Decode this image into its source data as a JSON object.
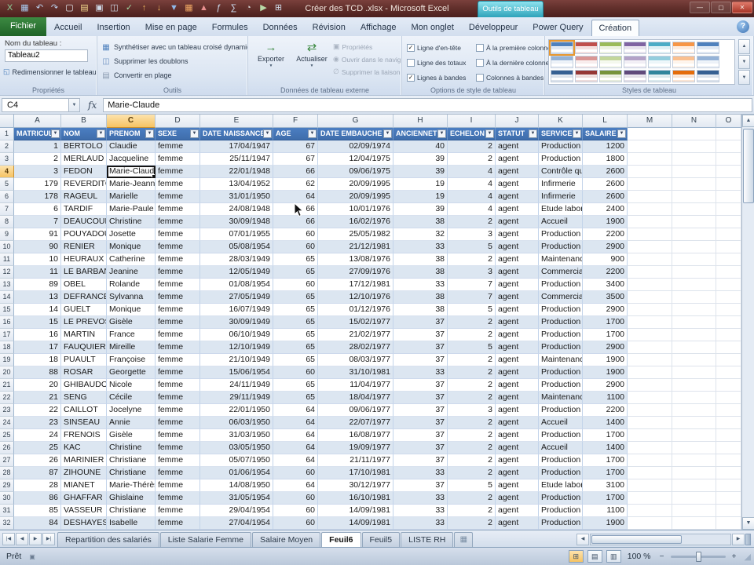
{
  "title_bar": {
    "title": "Créer des TCD .xlsx - Microsoft Excel",
    "context_label": "Outils de tableau",
    "window_controls": {
      "minimize": "—",
      "maximize": "▢",
      "close": "✕"
    },
    "qat_icons": [
      {
        "name": "excel-logo-icon",
        "glyph": "X",
        "color": "#8fd49a"
      },
      {
        "name": "save-icon",
        "glyph": "▦",
        "color": "#a9c9ee"
      },
      {
        "name": "undo-icon",
        "glyph": "↶",
        "color": "#bcd2ee"
      },
      {
        "name": "redo-icon",
        "glyph": "↷",
        "color": "#bcd2ee"
      },
      {
        "name": "new-workbook-icon",
        "glyph": "▢",
        "color": "#e8eef5"
      },
      {
        "name": "open-icon",
        "glyph": "▤",
        "color": "#f4d98e"
      },
      {
        "name": "quick-print-icon",
        "glyph": "▣",
        "color": "#cfd8e6"
      },
      {
        "name": "print-preview-icon",
        "glyph": "◫",
        "color": "#cfd8e6"
      },
      {
        "name": "spelling-icon",
        "glyph": "✓",
        "color": "#9fd49f"
      },
      {
        "name": "sort-asc-icon",
        "glyph": "↑",
        "color": "#f0b65e"
      },
      {
        "name": "sort-desc-icon",
        "glyph": "↓",
        "color": "#f0b65e"
      },
      {
        "name": "filter-icon",
        "glyph": "▼",
        "color": "#8fb7e8"
      },
      {
        "name": "pivot-table-icon",
        "glyph": "▦",
        "color": "#f0a864"
      },
      {
        "name": "chart-icon",
        "glyph": "▲",
        "color": "#e88f8f"
      },
      {
        "name": "insert-function-icon",
        "glyph": "ƒ",
        "color": "#cfe0f4"
      },
      {
        "name": "autosum-icon",
        "glyph": "∑",
        "color": "#cfe0f4"
      },
      {
        "name": "camera-icon",
        "glyph": "◔",
        "color": "#d8d8d8"
      },
      {
        "name": "macro-icon",
        "glyph": "▶",
        "color": "#b9d9a8"
      },
      {
        "name": "calculator-icon",
        "glyph": "⊞",
        "color": "#d0dcea"
      }
    ]
  },
  "ribbon": {
    "help_label": "?",
    "tabs": [
      {
        "label": "Fichier",
        "file": true
      },
      {
        "label": "Accueil"
      },
      {
        "label": "Insertion"
      },
      {
        "label": "Mise en page"
      },
      {
        "label": "Formules"
      },
      {
        "label": "Données"
      },
      {
        "label": "Révision"
      },
      {
        "label": "Affichage"
      },
      {
        "label": "Mon onglet"
      },
      {
        "label": "Développeur"
      },
      {
        "label": "Power Query"
      },
      {
        "label": "Création",
        "active": true
      }
    ],
    "groups": {
      "proprietes": {
        "title": "Propriétés",
        "name_label": "Nom du tableau :",
        "table_name": "Tableau2",
        "resize_label": "Redimensionner le tableau"
      },
      "outils": {
        "title": "Outils",
        "items": [
          "Synthétiser avec un tableau croisé dynamique",
          "Supprimer les doublons",
          "Convertir en plage"
        ]
      },
      "externe": {
        "title": "Données de tableau externe",
        "buttons": [
          "Exporter",
          "Actualiser"
        ],
        "links": [
          {
            "label": "Propriétés",
            "enabled": false
          },
          {
            "label": "Ouvrir dans le navigateur",
            "enabled": false
          },
          {
            "label": "Supprimer la liaison",
            "enabled": false
          }
        ]
      },
      "options": {
        "title": "Options de style de tableau",
        "checkboxes": [
          {
            "label": "Ligne d'en-tête",
            "checked": true
          },
          {
            "label": "Ligne des totaux",
            "checked": false
          },
          {
            "label": "Lignes à bandes",
            "checked": true
          },
          {
            "label": "À la première colonne",
            "checked": false
          },
          {
            "label": "À la dernière colonne",
            "checked": false
          },
          {
            "label": "Colonnes à bandes",
            "checked": false
          }
        ]
      },
      "styles": {
        "title": "Styles de tableau",
        "selected_index": 0,
        "swatch_colors": [
          "#4f81bd",
          "#c0504d",
          "#9bbb59",
          "#8064a2",
          "#4bacc6",
          "#f79646",
          "#4f81bd",
          "#95b3d7",
          "#d99694",
          "#c3d69b",
          "#b3a2c7",
          "#93cddd",
          "#fac090",
          "#95b3d7",
          "#366092",
          "#953735",
          "#76933c",
          "#604a7b",
          "#31859c",
          "#e46c0a",
          "#366092"
        ]
      }
    }
  },
  "formula_bar": {
    "name_box": "C4",
    "fx_label": "fx",
    "value": "Marie-Claude"
  },
  "grid": {
    "column_letters": [
      "A",
      "B",
      "C",
      "D",
      "E",
      "F",
      "G",
      "H",
      "I",
      "J",
      "K",
      "L",
      "M",
      "N",
      "O"
    ],
    "selected_cell": "C4",
    "selected_row": 4,
    "selected_col_index": 2,
    "selected_col_letter": "C",
    "table": {
      "header_fill": "#4374b9",
      "band_fill": "#dce6f1",
      "headers": [
        "MATRICULE",
        "NOM",
        "PRENOM",
        "SEXE",
        "DATE NAISSANCE",
        "AGE",
        "DATE EMBAUCHE",
        "ANCIENNETE",
        "ECHELON",
        "STATUT",
        "SERVICE",
        "SALAIRE"
      ],
      "rows": [
        [
          1,
          "BERTOLO",
          "Claudie",
          "femme",
          "17/04/1947",
          67,
          "02/09/1974",
          40,
          2,
          "agent",
          "Production",
          1200
        ],
        [
          2,
          "MERLAUD",
          "Jacqueline",
          "femme",
          "25/11/1947",
          67,
          "12/04/1975",
          39,
          2,
          "agent",
          "Production",
          1800
        ],
        [
          3,
          "FEDON",
          "Marie-Claude",
          "femme",
          "22/01/1948",
          66,
          "09/06/1975",
          39,
          4,
          "agent",
          "Contrôle qual",
          2600
        ],
        [
          179,
          "REVERDITO",
          "Marie-Jeanne",
          "femme",
          "13/04/1952",
          62,
          "20/09/1995",
          19,
          4,
          "agent",
          "Infirmerie",
          2600
        ],
        [
          178,
          "RAGEUL",
          "Marielle",
          "femme",
          "31/01/1950",
          64,
          "20/09/1995",
          19,
          4,
          "agent",
          "Infirmerie",
          2600
        ],
        [
          6,
          "TARDIF",
          "Marie-Paule",
          "femme",
          "24/08/1948",
          66,
          "10/01/1976",
          39,
          4,
          "agent",
          "Etude laborat",
          2400
        ],
        [
          7,
          "DEAUCOURT",
          "Christine",
          "femme",
          "30/09/1948",
          66,
          "16/02/1976",
          38,
          2,
          "agent",
          "Accueil",
          1900
        ],
        [
          91,
          "POUYADOU",
          "Josette",
          "femme",
          "07/01/1955",
          60,
          "25/05/1982",
          32,
          3,
          "agent",
          "Production",
          2200
        ],
        [
          90,
          "RENIER",
          "Monique",
          "femme",
          "05/08/1954",
          60,
          "21/12/1981",
          33,
          5,
          "agent",
          "Production",
          2900
        ],
        [
          10,
          "HEURAUX",
          "Catherine",
          "femme",
          "28/03/1949",
          65,
          "13/08/1976",
          38,
          2,
          "agent",
          "Maintenance",
          900
        ],
        [
          11,
          "LE BARBANT",
          "Jeanine",
          "femme",
          "12/05/1949",
          65,
          "27/09/1976",
          38,
          3,
          "agent",
          "Commercial",
          2200
        ],
        [
          89,
          "OBEL",
          "Rolande",
          "femme",
          "01/08/1954",
          60,
          "17/12/1981",
          33,
          7,
          "agent",
          "Production",
          3400
        ],
        [
          13,
          "DEFRANCE",
          "Sylvanna",
          "femme",
          "27/05/1949",
          65,
          "12/10/1976",
          38,
          7,
          "agent",
          "Commercial",
          3500
        ],
        [
          14,
          "GUELT",
          "Monique",
          "femme",
          "16/07/1949",
          65,
          "01/12/1976",
          38,
          5,
          "agent",
          "Production",
          2900
        ],
        [
          15,
          "LE PREVOST",
          "Gisèle",
          "femme",
          "30/09/1949",
          65,
          "15/02/1977",
          37,
          2,
          "agent",
          "Production",
          1700
        ],
        [
          16,
          "MARTIN",
          "France",
          "femme",
          "06/10/1949",
          65,
          "21/02/1977",
          37,
          2,
          "agent",
          "Production",
          1700
        ],
        [
          17,
          "FAUQUIER",
          "Mireille",
          "femme",
          "12/10/1949",
          65,
          "28/02/1977",
          37,
          5,
          "agent",
          "Production",
          2900
        ],
        [
          18,
          "PUAULT",
          "Françoise",
          "femme",
          "21/10/1949",
          65,
          "08/03/1977",
          37,
          2,
          "agent",
          "Maintenance",
          1900
        ],
        [
          88,
          "ROSAR",
          "Georgette",
          "femme",
          "15/06/1954",
          60,
          "31/10/1981",
          33,
          2,
          "agent",
          "Production",
          1900
        ],
        [
          20,
          "GHIBAUDO",
          "Nicole",
          "femme",
          "24/11/1949",
          65,
          "11/04/1977",
          37,
          2,
          "agent",
          "Production",
          2900
        ],
        [
          21,
          "SENG",
          "Cécile",
          "femme",
          "29/11/1949",
          65,
          "18/04/1977",
          37,
          2,
          "agent",
          "Maintenance",
          1100
        ],
        [
          22,
          "CAILLOT",
          "Jocelyne",
          "femme",
          "22/01/1950",
          64,
          "09/06/1977",
          37,
          3,
          "agent",
          "Production",
          2200
        ],
        [
          23,
          "SINSEAU",
          "Annie",
          "femme",
          "06/03/1950",
          64,
          "22/07/1977",
          37,
          2,
          "agent",
          "Accueil",
          1400
        ],
        [
          24,
          "FRENOIS",
          "Gisèle",
          "femme",
          "31/03/1950",
          64,
          "16/08/1977",
          37,
          2,
          "agent",
          "Production",
          1700
        ],
        [
          25,
          "KAC",
          "Christine",
          "femme",
          "03/05/1950",
          64,
          "19/09/1977",
          37,
          2,
          "agent",
          "Accueil",
          1400
        ],
        [
          26,
          "MARINIER",
          "Christiane",
          "femme",
          "05/07/1950",
          64,
          "21/11/1977",
          37,
          2,
          "agent",
          "Production",
          1700
        ],
        [
          87,
          "ZIHOUNE",
          "Christiane",
          "femme",
          "01/06/1954",
          60,
          "17/10/1981",
          33,
          2,
          "agent",
          "Production",
          1700
        ],
        [
          28,
          "MIANET",
          "Marie-Thérèse",
          "femme",
          "14/08/1950",
          64,
          "30/12/1977",
          37,
          5,
          "agent",
          "Etude laborat",
          3100
        ],
        [
          86,
          "GHAFFAR",
          "Ghislaine",
          "femme",
          "31/05/1954",
          60,
          "16/10/1981",
          33,
          2,
          "agent",
          "Production",
          1700
        ],
        [
          85,
          "VASSEUR",
          "Christiane",
          "femme",
          "29/04/1954",
          60,
          "14/09/1981",
          33,
          2,
          "agent",
          "Production",
          1100
        ],
        [
          84,
          "DESHAYES",
          "Isabelle",
          "femme",
          "27/04/1954",
          60,
          "14/09/1981",
          33,
          2,
          "agent",
          "Production",
          1900
        ]
      ]
    }
  },
  "sheet_tabs": {
    "tabs": [
      {
        "label": "Repartition des salariés"
      },
      {
        "label": "Liste Salarie Femme"
      },
      {
        "label": "Salaire Moyen"
      },
      {
        "label": "Feuil6",
        "active": true
      },
      {
        "label": "Feuil5"
      },
      {
        "label": "LISTE RH"
      }
    ]
  },
  "status_bar": {
    "ready_label": "Prêt",
    "zoom_label": "100 %"
  }
}
